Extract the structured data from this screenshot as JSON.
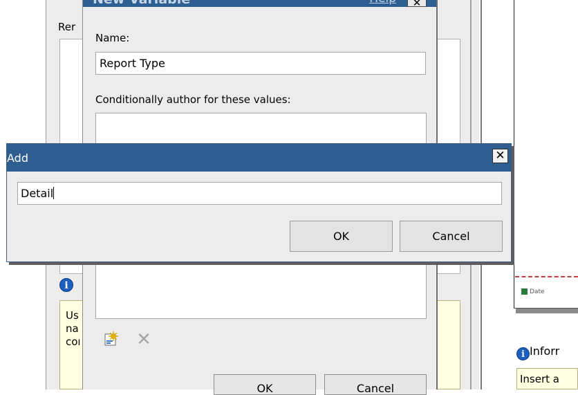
{
  "background_dialog": {
    "label_partial": "Rer",
    "info_text_lines": [
      "Us",
      "na",
      "coı"
    ]
  },
  "new_variable_dialog": {
    "title": "New Variable",
    "help_link": "Help",
    "close_glyph": "✕",
    "name_label": "Name:",
    "name_value": "Report Type",
    "conditional_label": "Conditionally author for these values:",
    "new_icon": "new-item-icon",
    "delete_icon": "delete-icon",
    "ok_label": "OK",
    "cancel_label": "Cancel"
  },
  "document_area": {
    "date_field_label": "Date",
    "info_title": "Inforr",
    "info_text": "Insert a"
  },
  "add_dialog": {
    "title": "Add",
    "close_glyph": "✕",
    "input_value": "Detail",
    "ok_label": "OK",
    "cancel_label": "Cancel"
  }
}
